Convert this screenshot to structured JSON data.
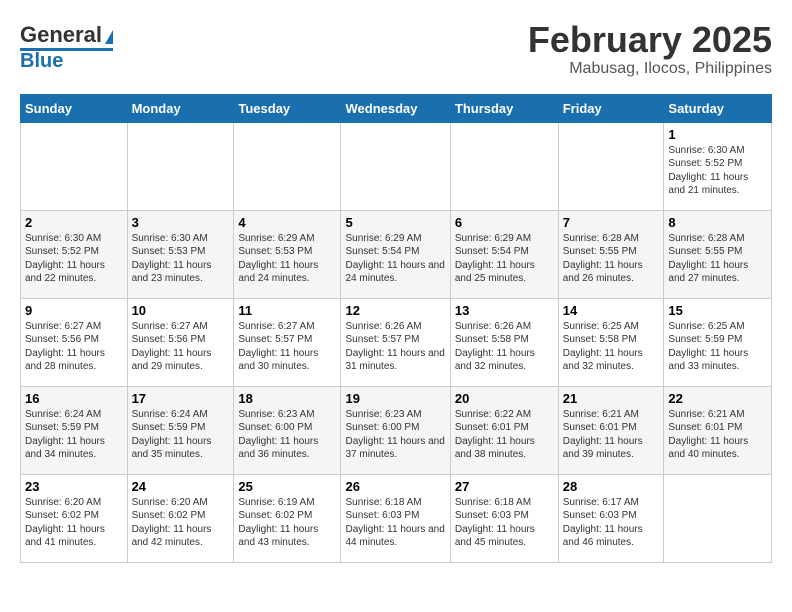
{
  "header": {
    "logo_line1": "General",
    "logo_line2": "Blue",
    "month": "February 2025",
    "location": "Mabusag, Ilocos, Philippines"
  },
  "days_of_week": [
    "Sunday",
    "Monday",
    "Tuesday",
    "Wednesday",
    "Thursday",
    "Friday",
    "Saturday"
  ],
  "weeks": [
    [
      {
        "day": "",
        "info": ""
      },
      {
        "day": "",
        "info": ""
      },
      {
        "day": "",
        "info": ""
      },
      {
        "day": "",
        "info": ""
      },
      {
        "day": "",
        "info": ""
      },
      {
        "day": "",
        "info": ""
      },
      {
        "day": "1",
        "info": "Sunrise: 6:30 AM\nSunset: 5:52 PM\nDaylight: 11 hours and 21 minutes."
      }
    ],
    [
      {
        "day": "2",
        "info": "Sunrise: 6:30 AM\nSunset: 5:52 PM\nDaylight: 11 hours and 22 minutes."
      },
      {
        "day": "3",
        "info": "Sunrise: 6:30 AM\nSunset: 5:53 PM\nDaylight: 11 hours and 23 minutes."
      },
      {
        "day": "4",
        "info": "Sunrise: 6:29 AM\nSunset: 5:53 PM\nDaylight: 11 hours and 24 minutes."
      },
      {
        "day": "5",
        "info": "Sunrise: 6:29 AM\nSunset: 5:54 PM\nDaylight: 11 hours and 24 minutes."
      },
      {
        "day": "6",
        "info": "Sunrise: 6:29 AM\nSunset: 5:54 PM\nDaylight: 11 hours and 25 minutes."
      },
      {
        "day": "7",
        "info": "Sunrise: 6:28 AM\nSunset: 5:55 PM\nDaylight: 11 hours and 26 minutes."
      },
      {
        "day": "8",
        "info": "Sunrise: 6:28 AM\nSunset: 5:55 PM\nDaylight: 11 hours and 27 minutes."
      }
    ],
    [
      {
        "day": "9",
        "info": "Sunrise: 6:27 AM\nSunset: 5:56 PM\nDaylight: 11 hours and 28 minutes."
      },
      {
        "day": "10",
        "info": "Sunrise: 6:27 AM\nSunset: 5:56 PM\nDaylight: 11 hours and 29 minutes."
      },
      {
        "day": "11",
        "info": "Sunrise: 6:27 AM\nSunset: 5:57 PM\nDaylight: 11 hours and 30 minutes."
      },
      {
        "day": "12",
        "info": "Sunrise: 6:26 AM\nSunset: 5:57 PM\nDaylight: 11 hours and 31 minutes."
      },
      {
        "day": "13",
        "info": "Sunrise: 6:26 AM\nSunset: 5:58 PM\nDaylight: 11 hours and 32 minutes."
      },
      {
        "day": "14",
        "info": "Sunrise: 6:25 AM\nSunset: 5:58 PM\nDaylight: 11 hours and 32 minutes."
      },
      {
        "day": "15",
        "info": "Sunrise: 6:25 AM\nSunset: 5:59 PM\nDaylight: 11 hours and 33 minutes."
      }
    ],
    [
      {
        "day": "16",
        "info": "Sunrise: 6:24 AM\nSunset: 5:59 PM\nDaylight: 11 hours and 34 minutes."
      },
      {
        "day": "17",
        "info": "Sunrise: 6:24 AM\nSunset: 5:59 PM\nDaylight: 11 hours and 35 minutes."
      },
      {
        "day": "18",
        "info": "Sunrise: 6:23 AM\nSunset: 6:00 PM\nDaylight: 11 hours and 36 minutes."
      },
      {
        "day": "19",
        "info": "Sunrise: 6:23 AM\nSunset: 6:00 PM\nDaylight: 11 hours and 37 minutes."
      },
      {
        "day": "20",
        "info": "Sunrise: 6:22 AM\nSunset: 6:01 PM\nDaylight: 11 hours and 38 minutes."
      },
      {
        "day": "21",
        "info": "Sunrise: 6:21 AM\nSunset: 6:01 PM\nDaylight: 11 hours and 39 minutes."
      },
      {
        "day": "22",
        "info": "Sunrise: 6:21 AM\nSunset: 6:01 PM\nDaylight: 11 hours and 40 minutes."
      }
    ],
    [
      {
        "day": "23",
        "info": "Sunrise: 6:20 AM\nSunset: 6:02 PM\nDaylight: 11 hours and 41 minutes."
      },
      {
        "day": "24",
        "info": "Sunrise: 6:20 AM\nSunset: 6:02 PM\nDaylight: 11 hours and 42 minutes."
      },
      {
        "day": "25",
        "info": "Sunrise: 6:19 AM\nSunset: 6:02 PM\nDaylight: 11 hours and 43 minutes."
      },
      {
        "day": "26",
        "info": "Sunrise: 6:18 AM\nSunset: 6:03 PM\nDaylight: 11 hours and 44 minutes."
      },
      {
        "day": "27",
        "info": "Sunrise: 6:18 AM\nSunset: 6:03 PM\nDaylight: 11 hours and 45 minutes."
      },
      {
        "day": "28",
        "info": "Sunrise: 6:17 AM\nSunset: 6:03 PM\nDaylight: 11 hours and 46 minutes."
      },
      {
        "day": "",
        "info": ""
      }
    ]
  ]
}
